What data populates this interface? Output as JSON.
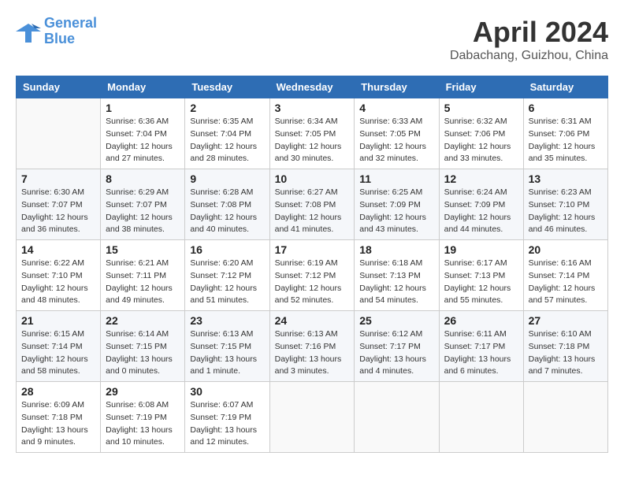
{
  "logo": {
    "line1": "General",
    "line2": "Blue"
  },
  "title": "April 2024",
  "location": "Dabachang, Guizhou, China",
  "days_of_week": [
    "Sunday",
    "Monday",
    "Tuesday",
    "Wednesday",
    "Thursday",
    "Friday",
    "Saturday"
  ],
  "weeks": [
    [
      {
        "day": "",
        "info": ""
      },
      {
        "day": "1",
        "info": "Sunrise: 6:36 AM\nSunset: 7:04 PM\nDaylight: 12 hours\nand 27 minutes."
      },
      {
        "day": "2",
        "info": "Sunrise: 6:35 AM\nSunset: 7:04 PM\nDaylight: 12 hours\nand 28 minutes."
      },
      {
        "day": "3",
        "info": "Sunrise: 6:34 AM\nSunset: 7:05 PM\nDaylight: 12 hours\nand 30 minutes."
      },
      {
        "day": "4",
        "info": "Sunrise: 6:33 AM\nSunset: 7:05 PM\nDaylight: 12 hours\nand 32 minutes."
      },
      {
        "day": "5",
        "info": "Sunrise: 6:32 AM\nSunset: 7:06 PM\nDaylight: 12 hours\nand 33 minutes."
      },
      {
        "day": "6",
        "info": "Sunrise: 6:31 AM\nSunset: 7:06 PM\nDaylight: 12 hours\nand 35 minutes."
      }
    ],
    [
      {
        "day": "7",
        "info": "Sunrise: 6:30 AM\nSunset: 7:07 PM\nDaylight: 12 hours\nand 36 minutes."
      },
      {
        "day": "8",
        "info": "Sunrise: 6:29 AM\nSunset: 7:07 PM\nDaylight: 12 hours\nand 38 minutes."
      },
      {
        "day": "9",
        "info": "Sunrise: 6:28 AM\nSunset: 7:08 PM\nDaylight: 12 hours\nand 40 minutes."
      },
      {
        "day": "10",
        "info": "Sunrise: 6:27 AM\nSunset: 7:08 PM\nDaylight: 12 hours\nand 41 minutes."
      },
      {
        "day": "11",
        "info": "Sunrise: 6:25 AM\nSunset: 7:09 PM\nDaylight: 12 hours\nand 43 minutes."
      },
      {
        "day": "12",
        "info": "Sunrise: 6:24 AM\nSunset: 7:09 PM\nDaylight: 12 hours\nand 44 minutes."
      },
      {
        "day": "13",
        "info": "Sunrise: 6:23 AM\nSunset: 7:10 PM\nDaylight: 12 hours\nand 46 minutes."
      }
    ],
    [
      {
        "day": "14",
        "info": "Sunrise: 6:22 AM\nSunset: 7:10 PM\nDaylight: 12 hours\nand 48 minutes."
      },
      {
        "day": "15",
        "info": "Sunrise: 6:21 AM\nSunset: 7:11 PM\nDaylight: 12 hours\nand 49 minutes."
      },
      {
        "day": "16",
        "info": "Sunrise: 6:20 AM\nSunset: 7:12 PM\nDaylight: 12 hours\nand 51 minutes."
      },
      {
        "day": "17",
        "info": "Sunrise: 6:19 AM\nSunset: 7:12 PM\nDaylight: 12 hours\nand 52 minutes."
      },
      {
        "day": "18",
        "info": "Sunrise: 6:18 AM\nSunset: 7:13 PM\nDaylight: 12 hours\nand 54 minutes."
      },
      {
        "day": "19",
        "info": "Sunrise: 6:17 AM\nSunset: 7:13 PM\nDaylight: 12 hours\nand 55 minutes."
      },
      {
        "day": "20",
        "info": "Sunrise: 6:16 AM\nSunset: 7:14 PM\nDaylight: 12 hours\nand 57 minutes."
      }
    ],
    [
      {
        "day": "21",
        "info": "Sunrise: 6:15 AM\nSunset: 7:14 PM\nDaylight: 12 hours\nand 58 minutes."
      },
      {
        "day": "22",
        "info": "Sunrise: 6:14 AM\nSunset: 7:15 PM\nDaylight: 13 hours\nand 0 minutes."
      },
      {
        "day": "23",
        "info": "Sunrise: 6:13 AM\nSunset: 7:15 PM\nDaylight: 13 hours\nand 1 minute."
      },
      {
        "day": "24",
        "info": "Sunrise: 6:13 AM\nSunset: 7:16 PM\nDaylight: 13 hours\nand 3 minutes."
      },
      {
        "day": "25",
        "info": "Sunrise: 6:12 AM\nSunset: 7:17 PM\nDaylight: 13 hours\nand 4 minutes."
      },
      {
        "day": "26",
        "info": "Sunrise: 6:11 AM\nSunset: 7:17 PM\nDaylight: 13 hours\nand 6 minutes."
      },
      {
        "day": "27",
        "info": "Sunrise: 6:10 AM\nSunset: 7:18 PM\nDaylight: 13 hours\nand 7 minutes."
      }
    ],
    [
      {
        "day": "28",
        "info": "Sunrise: 6:09 AM\nSunset: 7:18 PM\nDaylight: 13 hours\nand 9 minutes."
      },
      {
        "day": "29",
        "info": "Sunrise: 6:08 AM\nSunset: 7:19 PM\nDaylight: 13 hours\nand 10 minutes."
      },
      {
        "day": "30",
        "info": "Sunrise: 6:07 AM\nSunset: 7:19 PM\nDaylight: 13 hours\nand 12 minutes."
      },
      {
        "day": "",
        "info": ""
      },
      {
        "day": "",
        "info": ""
      },
      {
        "day": "",
        "info": ""
      },
      {
        "day": "",
        "info": ""
      }
    ]
  ]
}
